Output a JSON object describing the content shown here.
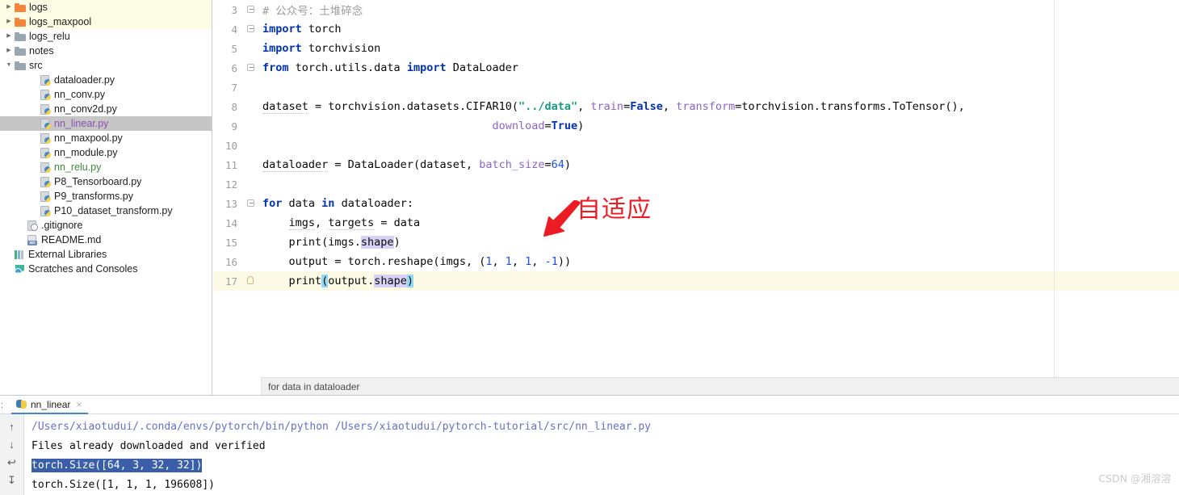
{
  "sidebar": {
    "items": [
      {
        "label": "logs",
        "icon": "folder-icon-orange",
        "indent": 0,
        "twisty": "collapsed",
        "highlight": "yellow",
        "color": "default"
      },
      {
        "label": "logs_maxpool",
        "icon": "folder-icon-orange",
        "indent": 0,
        "twisty": "collapsed",
        "highlight": "yellow",
        "color": "default"
      },
      {
        "label": "logs_relu",
        "icon": "folder-icon",
        "indent": 0,
        "twisty": "collapsed",
        "highlight": "none",
        "color": "default"
      },
      {
        "label": "notes",
        "icon": "folder-icon",
        "indent": 0,
        "twisty": "collapsed",
        "highlight": "none",
        "color": "default"
      },
      {
        "label": "src",
        "icon": "folder-icon",
        "indent": 0,
        "twisty": "expanded",
        "highlight": "none",
        "color": "default"
      },
      {
        "label": "dataloader.py",
        "icon": "python-file-icon",
        "indent": 2,
        "twisty": "none",
        "highlight": "none",
        "color": "default"
      },
      {
        "label": "nn_conv.py",
        "icon": "python-file-icon",
        "indent": 2,
        "twisty": "none",
        "highlight": "none",
        "color": "default"
      },
      {
        "label": "nn_conv2d.py",
        "icon": "python-file-icon",
        "indent": 2,
        "twisty": "none",
        "highlight": "none",
        "color": "default"
      },
      {
        "label": "nn_linear.py",
        "icon": "python-file-icon",
        "indent": 2,
        "twisty": "none",
        "highlight": "grey",
        "color": "purple"
      },
      {
        "label": "nn_maxpool.py",
        "icon": "python-file-icon",
        "indent": 2,
        "twisty": "none",
        "highlight": "none",
        "color": "default"
      },
      {
        "label": "nn_module.py",
        "icon": "python-file-icon",
        "indent": 2,
        "twisty": "none",
        "highlight": "none",
        "color": "default"
      },
      {
        "label": "nn_relu.py",
        "icon": "python-file-icon",
        "indent": 2,
        "twisty": "none",
        "highlight": "none",
        "color": "green"
      },
      {
        "label": "P8_Tensorboard.py",
        "icon": "python-file-icon",
        "indent": 2,
        "twisty": "none",
        "highlight": "none",
        "color": "default"
      },
      {
        "label": "P9_transforms.py",
        "icon": "python-file-icon",
        "indent": 2,
        "twisty": "none",
        "highlight": "none",
        "color": "default"
      },
      {
        "label": "P10_dataset_transform.py",
        "icon": "python-file-icon",
        "indent": 2,
        "twisty": "none",
        "highlight": "none",
        "color": "default"
      },
      {
        "label": ".gitignore",
        "icon": "gitignore-file-icon",
        "indent": 1,
        "twisty": "none",
        "highlight": "none",
        "color": "default"
      },
      {
        "label": "README.md",
        "icon": "markdown-file-icon",
        "indent": 1,
        "twisty": "none",
        "highlight": "none",
        "color": "default"
      },
      {
        "label": "External Libraries",
        "icon": "library-icon",
        "indent": 0,
        "twisty": "none",
        "highlight": "none",
        "color": "default"
      },
      {
        "label": "Scratches and Consoles",
        "icon": "scratches-icon",
        "indent": 0,
        "twisty": "none",
        "highlight": "none",
        "color": "default"
      }
    ]
  },
  "editor": {
    "lines": [
      {
        "n": "3",
        "fold": "box",
        "current": false,
        "tokens": [
          {
            "t": "# 公众号：土堆碎念",
            "c": "cmt"
          }
        ]
      },
      {
        "n": "4",
        "fold": "box",
        "current": false,
        "tokens": [
          {
            "t": "import",
            "c": "kw"
          },
          {
            "t": " torch",
            "c": "plain"
          }
        ]
      },
      {
        "n": "5",
        "fold": "none",
        "current": false,
        "tokens": [
          {
            "t": "import",
            "c": "kw"
          },
          {
            "t": " torchvision",
            "c": "plain"
          }
        ]
      },
      {
        "n": "6",
        "fold": "box",
        "current": false,
        "tokens": [
          {
            "t": "from",
            "c": "kw"
          },
          {
            "t": " torch.utils.data ",
            "c": "plain"
          },
          {
            "t": "import",
            "c": "kw"
          },
          {
            "t": " DataLoader",
            "c": "plain"
          }
        ]
      },
      {
        "n": "7",
        "fold": "none",
        "current": false,
        "tokens": []
      },
      {
        "n": "8",
        "fold": "none",
        "current": false,
        "tokens": [
          {
            "t": "dataset",
            "c": "sqgl"
          },
          {
            "t": " = torchvision.datasets.CIFAR10(",
            "c": "plain"
          },
          {
            "t": "\"../data\"",
            "c": "str"
          },
          {
            "t": ", ",
            "c": "plain"
          },
          {
            "t": "train",
            "c": "param"
          },
          {
            "t": "=",
            "c": "plain"
          },
          {
            "t": "False",
            "c": "bool"
          },
          {
            "t": ", ",
            "c": "plain"
          },
          {
            "t": "transform",
            "c": "param"
          },
          {
            "t": "=torchvision.transforms.ToTensor(),",
            "c": "plain"
          }
        ]
      },
      {
        "n": "9",
        "fold": "none",
        "current": false,
        "tokens": [
          {
            "t": "                                   ",
            "c": "plain"
          },
          {
            "t": "download",
            "c": "param"
          },
          {
            "t": "=",
            "c": "plain"
          },
          {
            "t": "True",
            "c": "bool"
          },
          {
            "t": ")",
            "c": "plain"
          }
        ]
      },
      {
        "n": "10",
        "fold": "none",
        "current": false,
        "tokens": []
      },
      {
        "n": "11",
        "fold": "none",
        "current": false,
        "tokens": [
          {
            "t": "dataloader",
            "c": "sqgl"
          },
          {
            "t": " = DataLoader(dataset, ",
            "c": "plain"
          },
          {
            "t": "batch_size",
            "c": "param"
          },
          {
            "t": "=",
            "c": "plain"
          },
          {
            "t": "64",
            "c": "num"
          },
          {
            "t": ")",
            "c": "plain"
          }
        ]
      },
      {
        "n": "12",
        "fold": "none",
        "current": false,
        "tokens": []
      },
      {
        "n": "13",
        "fold": "box",
        "current": false,
        "tokens": [
          {
            "t": "for",
            "c": "kw"
          },
          {
            "t": " data ",
            "c": "plain"
          },
          {
            "t": "in",
            "c": "kw"
          },
          {
            "t": " dataloader:",
            "c": "plain"
          }
        ]
      },
      {
        "n": "14",
        "fold": "none",
        "current": false,
        "tokens": [
          {
            "t": "    ",
            "c": "plain"
          },
          {
            "t": "imgs",
            "c": "sqgl"
          },
          {
            "t": ", ",
            "c": "plain"
          },
          {
            "t": "targets",
            "c": "sqgl"
          },
          {
            "t": " = data",
            "c": "plain"
          }
        ]
      },
      {
        "n": "15",
        "fold": "none",
        "current": false,
        "tokens": [
          {
            "t": "    print(imgs.",
            "c": "plain"
          },
          {
            "t": "shape",
            "c": "shp"
          },
          {
            "t": ")",
            "c": "plain"
          }
        ]
      },
      {
        "n": "16",
        "fold": "none",
        "current": false,
        "tokens": [
          {
            "t": "    output = torch.reshape(imgs, (",
            "c": "plain"
          },
          {
            "t": "1",
            "c": "num"
          },
          {
            "t": ", ",
            "c": "plain"
          },
          {
            "t": "1",
            "c": "num"
          },
          {
            "t": ", ",
            "c": "plain"
          },
          {
            "t": "1",
            "c": "num"
          },
          {
            "t": ", ",
            "c": "plain"
          },
          {
            "t": "-1",
            "c": "num"
          },
          {
            "t": "))",
            "c": "plain"
          }
        ]
      },
      {
        "n": "17",
        "fold": "bulb",
        "current": true,
        "tokens": [
          {
            "t": "    print",
            "c": "plain"
          },
          {
            "t": "(",
            "c": "brace"
          },
          {
            "t": "output.",
            "c": "plain"
          },
          {
            "t": "shape",
            "c": "shp"
          },
          {
            "t": ")",
            "c": "brace"
          }
        ]
      }
    ],
    "breadcrumb": "for data in dataloader"
  },
  "annotation": {
    "text": "自适应",
    "color": "#ed1c24",
    "icon": "red-arrow-icon"
  },
  "console": {
    "tab_label": "nn_linear",
    "tab_close": "×",
    "prefix_colon": ":",
    "gutter_buttons": [
      {
        "name": "scroll-up-button",
        "glyph": "↑"
      },
      {
        "name": "scroll-down-button",
        "glyph": "↓"
      },
      {
        "name": "soft-wrap-button",
        "glyph": "↩"
      },
      {
        "name": "scroll-to-end-button",
        "glyph": "↧"
      }
    ],
    "output": [
      {
        "text": "/Users/xiaotudui/.conda/envs/pytorch/bin/python /Users/xiaotudui/pytorch-tutorial/src/nn_linear.py",
        "style": "link"
      },
      {
        "text": "Files already downloaded and verified",
        "style": "plain"
      },
      {
        "text": "torch.Size([64, 3, 32, 32])",
        "style": "selected"
      },
      {
        "text": "torch.Size([1, 1, 1, 196608])",
        "style": "plain"
      }
    ]
  },
  "watermark": {
    "text": "CSDN @湘溶溶"
  }
}
